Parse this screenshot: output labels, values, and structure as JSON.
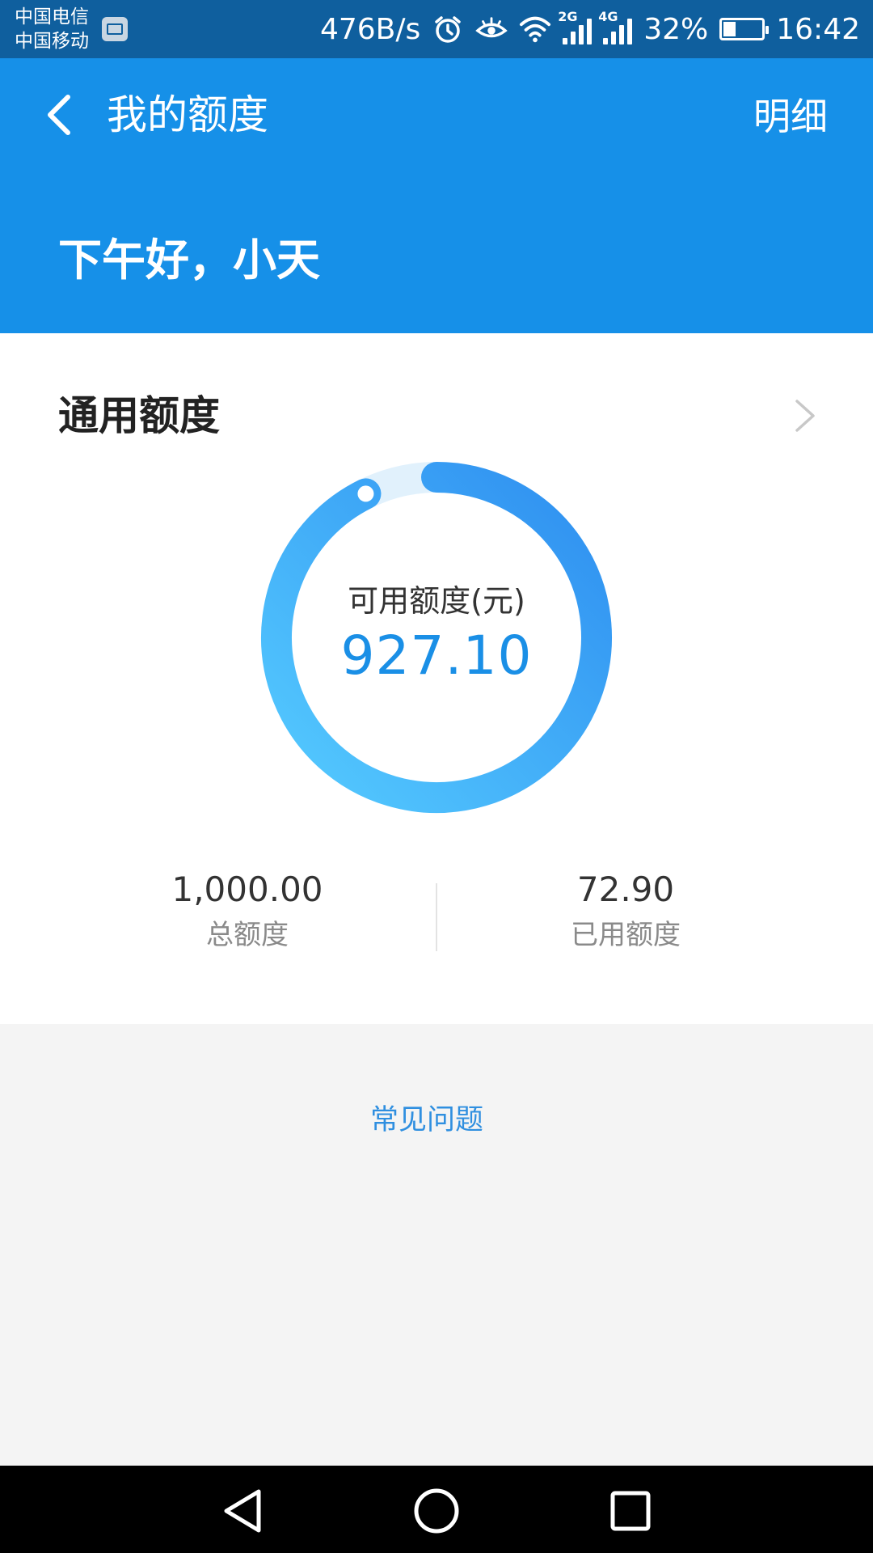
{
  "status_bar": {
    "carrier1": "中国电信",
    "carrier2": "中国移动",
    "net_speed": "476B/s",
    "sig1_type": "2G",
    "sig2_type": "4G",
    "battery_text": "32%",
    "battery_level": 0.32,
    "time": "16:42"
  },
  "header": {
    "title": "我的额度",
    "detail_label": "明细",
    "greeting": "下午好，小天"
  },
  "card": {
    "title": "通用额度",
    "ring_label": "可用额度(元)",
    "available": "927.10",
    "available_fraction": 0.9271,
    "total_value": "1,000.00",
    "total_label": "总额度",
    "used_value": "72.90",
    "used_label": "已用额度"
  },
  "faq_label": "常见问题",
  "colors": {
    "header_bg": "#1690e8",
    "statusbar_bg": "#0f5f9e",
    "accent": "#1a8fe6",
    "ring_start": "#2e8ef0",
    "ring_end": "#55cbff",
    "ring_track": "#e1f1fc"
  }
}
